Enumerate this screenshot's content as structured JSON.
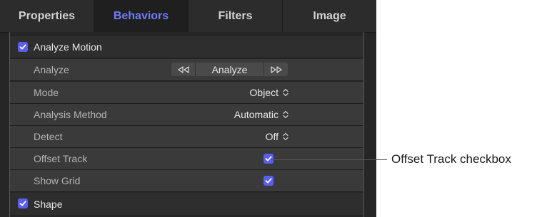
{
  "tabs": [
    {
      "label": "Properties",
      "active": false
    },
    {
      "label": "Behaviors",
      "active": true
    },
    {
      "label": "Filters",
      "active": false
    },
    {
      "label": "Image",
      "active": false
    }
  ],
  "analyze_motion": {
    "label": "Analyze Motion",
    "checked": true,
    "rows": {
      "analyze": {
        "label": "Analyze",
        "button_label": "Analyze"
      },
      "mode": {
        "label": "Mode",
        "value": "Object"
      },
      "analysis_method": {
        "label": "Analysis Method",
        "value": "Automatic"
      },
      "detect": {
        "label": "Detect",
        "value": "Off"
      },
      "offset_track": {
        "label": "Offset Track",
        "checked": true
      },
      "show_grid": {
        "label": "Show Grid",
        "checked": true
      }
    }
  },
  "shape": {
    "label": "Shape",
    "checked": true
  },
  "callout": {
    "label": "Offset Track checkbox"
  },
  "colors": {
    "accent": "#5b5ff0",
    "active_tab_text": "#6f7cff",
    "panel_bg": "#262626",
    "row_bg": "#3a3a3a"
  },
  "icons": {
    "checkbox": "checkmark-icon",
    "step_back": "step-backward-icon",
    "step_forward": "step-forward-icon",
    "popup": "updown-chevron-icon"
  }
}
